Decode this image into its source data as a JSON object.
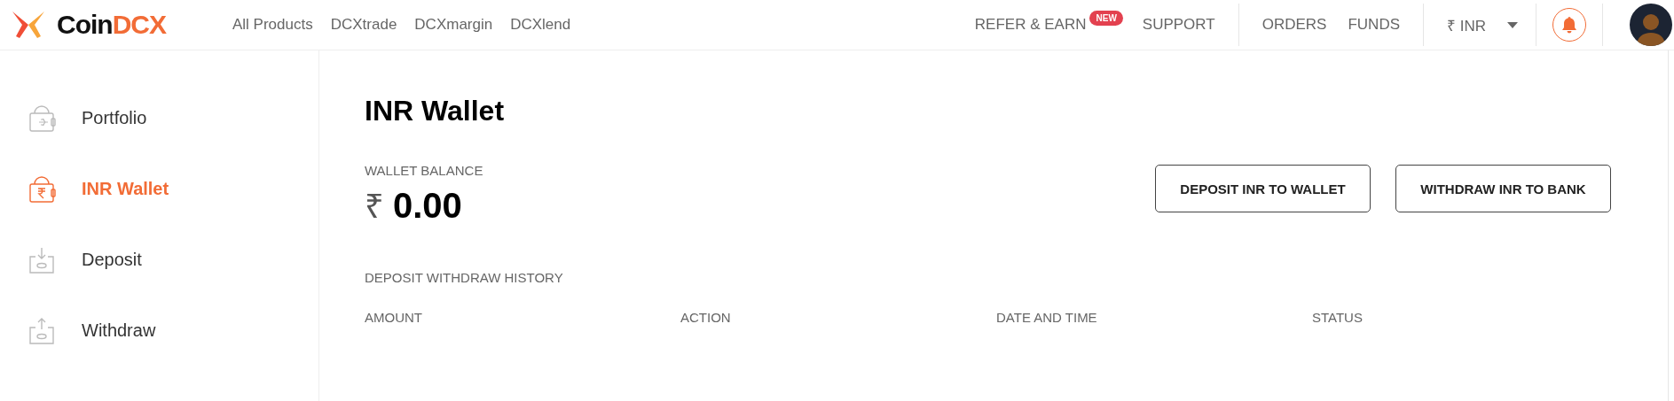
{
  "header": {
    "logo": {
      "first": "Coin",
      "second": "DCX"
    },
    "nav": [
      {
        "label": "All Products"
      },
      {
        "label": "DCXtrade"
      },
      {
        "label": "DCXmargin"
      },
      {
        "label": "DCXlend"
      }
    ],
    "refer": {
      "label": "REFER & EARN",
      "badge": "NEW"
    },
    "support": "SUPPORT",
    "orders": "ORDERS",
    "funds": "FUNDS",
    "currency": "₹ INR"
  },
  "sidebar": {
    "items": [
      {
        "label": "Portfolio",
        "kind": "portfolio",
        "selected": false
      },
      {
        "label": "INR Wallet",
        "kind": "wallet",
        "selected": true
      },
      {
        "label": "Deposit",
        "kind": "deposit",
        "selected": false
      },
      {
        "label": "Withdraw",
        "kind": "withdraw",
        "selected": false
      }
    ]
  },
  "main": {
    "title": "INR Wallet",
    "balance_label": "WALLET BALANCE",
    "currency_symbol": "₹",
    "balance": "0.00",
    "buttons": [
      "DEPOSIT INR TO WALLET",
      "WITHDRAW INR TO BANK"
    ],
    "history_label": "DEPOSIT WITHDRAW HISTORY",
    "columns": [
      "AMOUNT",
      "ACTION",
      "DATE AND TIME",
      "STATUS"
    ]
  }
}
